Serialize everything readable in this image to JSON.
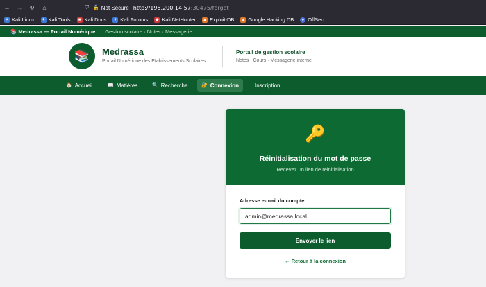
{
  "browser": {
    "not_secure_label": "Not Secure",
    "url_host": "http://195.200.14.57",
    "url_path": ":30475/forgot",
    "bookmarks": [
      {
        "label": "Kali Linux",
        "color": "#3f7bd6",
        "icon": "kali-dragon-icon"
      },
      {
        "label": "Kali Tools",
        "color": "#3f7bd6",
        "icon": "kali-dragon-icon"
      },
      {
        "label": "Kali Docs",
        "color": "#d23a3a",
        "icon": "kali-docs-icon"
      },
      {
        "label": "Kali Forums",
        "color": "#3f7bd6",
        "icon": "kali-dragon-icon"
      },
      {
        "label": "Kali NetHunter",
        "color": "#d23a3a",
        "icon": "nethunter-icon"
      },
      {
        "label": "Exploit-DB",
        "color": "#e07a2a",
        "icon": "exploitdb-icon"
      },
      {
        "label": "Google Hacking DB",
        "color": "#e07a2a",
        "icon": "ghdb-icon"
      },
      {
        "label": "OffSec",
        "color": "#4a6fd6",
        "icon": "offsec-icon"
      }
    ]
  },
  "topstrip": {
    "brand": "📚 Medrassa — Portail Numérique",
    "subtitle": "Gestion scolaire · Notes · Messagerie"
  },
  "header": {
    "logo_icon": "📚",
    "site_name": "Medrassa",
    "tagline": "Portail Numérique des Établissements Scolaires",
    "portal_title": "Portail de gestion scolaire",
    "portal_subtitle": "Notes · Cours · Messagerie interne"
  },
  "nav": {
    "items": [
      {
        "icon": "🏠",
        "label": "Accueil"
      },
      {
        "icon": "📖",
        "label": "Matières"
      },
      {
        "icon": "🔍",
        "label": "Recherche"
      },
      {
        "icon": "🔐",
        "label": "Connexion"
      },
      {
        "icon": "",
        "label": "Inscription"
      }
    ],
    "active": "Connexion"
  },
  "card": {
    "icon": "🔑",
    "title": "Réinitialisation du mot de passe",
    "subtitle": "Recevez un lien de réinitialisation",
    "email_label": "Adresse e-mail du compte",
    "email_value": "admin@medrassa.local",
    "submit_label": "Envoyer le lien",
    "back_label": "← Retour à la connexion"
  },
  "colors": {
    "brand_green": "#0d5c2e",
    "card_head_green": "#0d6a32",
    "key_yellow": "#f5c518"
  }
}
